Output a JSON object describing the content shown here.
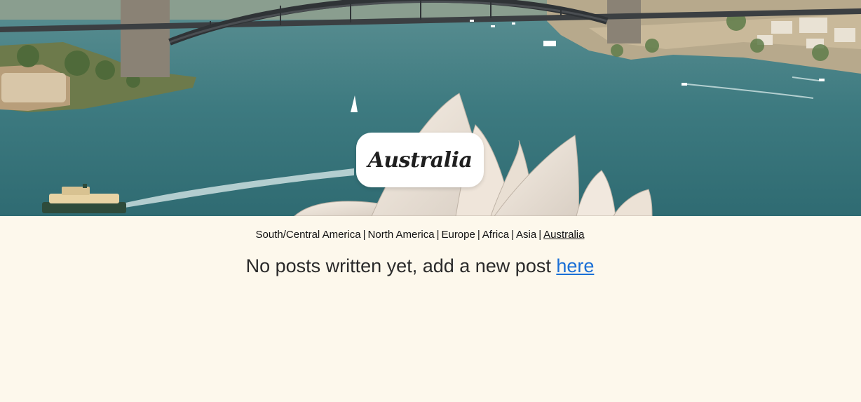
{
  "hero": {
    "title": "Australia",
    "icon": "sydney-harbour-photo"
  },
  "nav": {
    "items": [
      {
        "label": "South/Central America"
      },
      {
        "label": "North America"
      },
      {
        "label": "Europe"
      },
      {
        "label": "Africa"
      },
      {
        "label": "Asia"
      },
      {
        "label": "Australia",
        "active": true
      }
    ],
    "separator": "|"
  },
  "message": {
    "text": "No posts written yet, add a new post ",
    "link_label": "here"
  },
  "colors": {
    "background": "#fdf8ec",
    "link": "#1a6fd6",
    "water": "#3f7f86"
  }
}
